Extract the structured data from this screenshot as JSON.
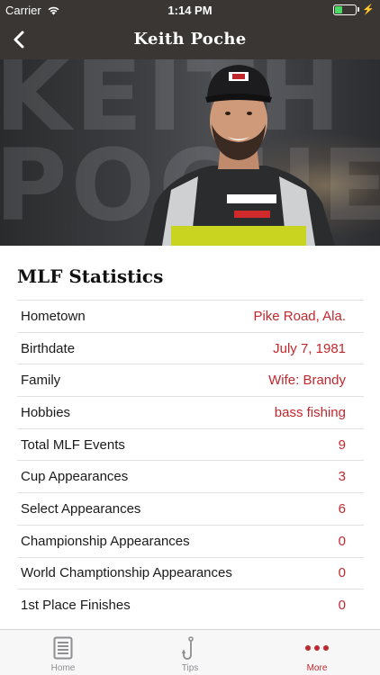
{
  "status_bar": {
    "carrier": "Carrier",
    "time": "1:14 PM",
    "battery_level": 0.35,
    "battery_color": "#4cd964"
  },
  "nav": {
    "title": "Keith Poche",
    "back_icon": "chevron-left-icon"
  },
  "hero": {
    "background_text": "KEITH POCHE",
    "image": "angler-portrait"
  },
  "stats": {
    "title": "MLF Statistics",
    "rows": [
      {
        "label": "Hometown",
        "value": "Pike Road, Ala."
      },
      {
        "label": "Birthdate",
        "value": "July 7, 1981"
      },
      {
        "label": "Family",
        "value": "Wife: Brandy"
      },
      {
        "label": "Hobbies",
        "value": "bass fishing"
      },
      {
        "label": "Total MLF Events",
        "value": "9"
      },
      {
        "label": "Cup Appearances",
        "value": "3"
      },
      {
        "label": "Select Appearances",
        "value": "6"
      },
      {
        "label": "Championship Appearances",
        "value": "0"
      },
      {
        "label": "World Champtionship Appearances",
        "value": "0"
      },
      {
        "label": "1st Place Finishes",
        "value": "0"
      }
    ]
  },
  "tabs": [
    {
      "label": "Home",
      "icon": "document-icon",
      "active": false
    },
    {
      "label": "Tips",
      "icon": "fish-hook-icon",
      "active": false
    },
    {
      "label": "More",
      "icon": "more-dots-icon",
      "active": true
    }
  ],
  "colors": {
    "header": "#3a3633",
    "accent": "#c1282d"
  }
}
